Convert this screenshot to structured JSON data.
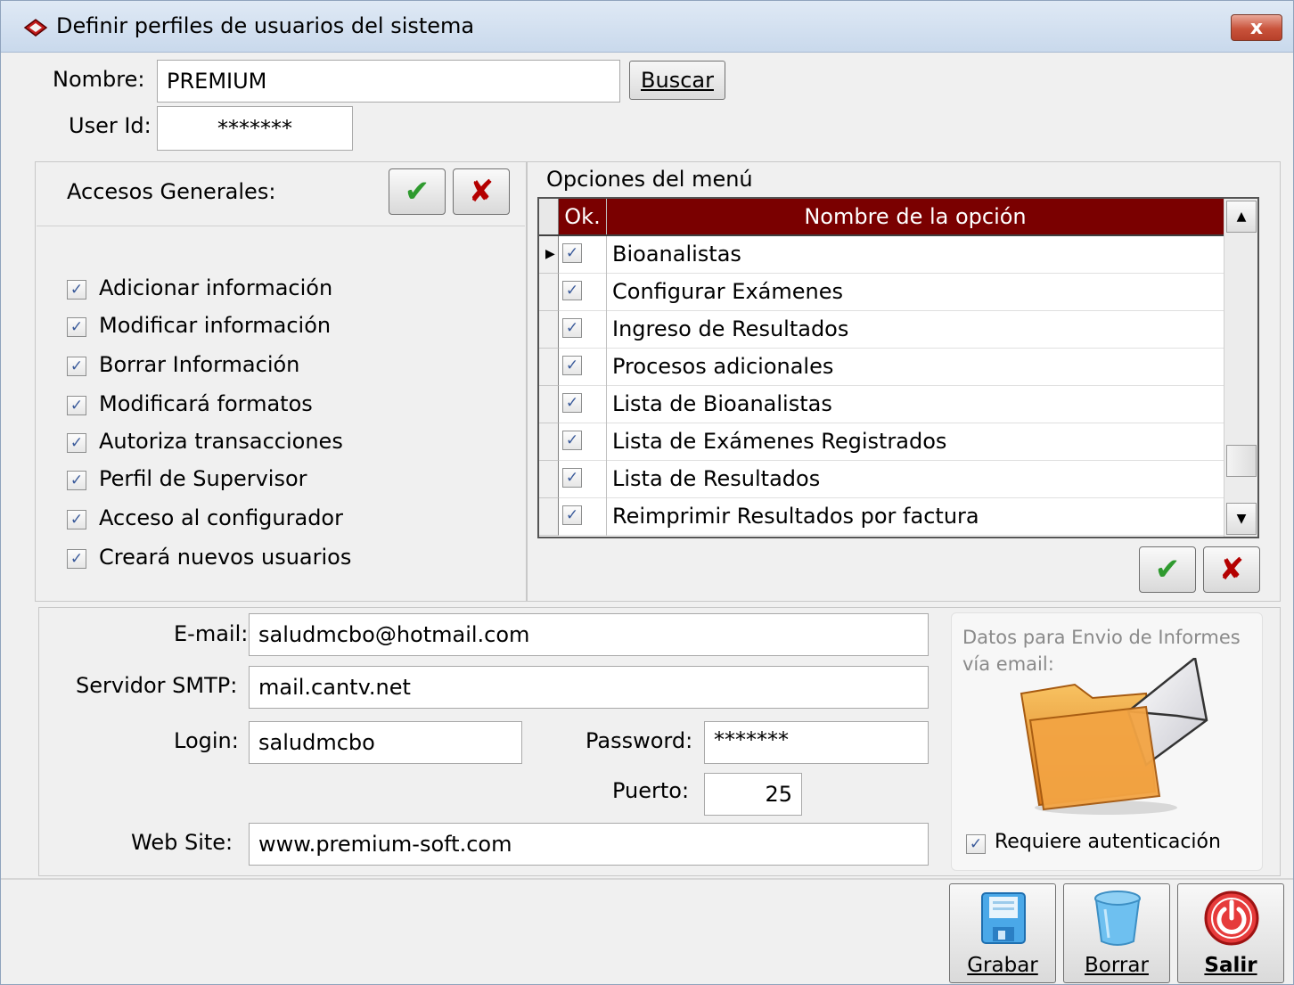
{
  "window": {
    "title": "Definir perfiles de usuarios del sistema",
    "close_label": "x"
  },
  "header": {
    "nombre_label": "Nombre:",
    "nombre_value": "PREMIUM",
    "buscar_label": "Buscar",
    "userid_label": "User Id:",
    "userid_value": "*******"
  },
  "accesos": {
    "title": "Accesos Generales:",
    "items": [
      {
        "label": "Adicionar información",
        "checked": true
      },
      {
        "label": "Modificar información",
        "checked": true
      },
      {
        "label": "Borrar Información",
        "checked": true
      },
      {
        "label": "Modificará formatos",
        "checked": true
      },
      {
        "label": "Autoriza transacciones",
        "checked": true
      },
      {
        "label": "Perfil de Supervisor",
        "checked": true
      },
      {
        "label": "Acceso al configurador",
        "checked": true
      },
      {
        "label": "Creará nuevos usuarios",
        "checked": true
      }
    ]
  },
  "menu": {
    "title": "Opciones del menú",
    "col_ok": "Ok.",
    "col_name": "Nombre de la opción",
    "rows": [
      {
        "name": "Bioanalistas",
        "checked": true
      },
      {
        "name": "Configurar Exámenes",
        "checked": true
      },
      {
        "name": "Ingreso de Resultados",
        "checked": true
      },
      {
        "name": "Procesos adicionales",
        "checked": true
      },
      {
        "name": "Lista de Bioanalistas",
        "checked": true
      },
      {
        "name": "Lista de Exámenes Registrados",
        "checked": true
      },
      {
        "name": "Lista de Resultados",
        "checked": true
      },
      {
        "name": "Reimprimir Resultados por factura",
        "checked": true
      }
    ]
  },
  "email": {
    "email_label": "E-mail:",
    "email_value": "saludmcbo@hotmail.com",
    "smtp_label": "Servidor SMTP:",
    "smtp_value": "mail.cantv.net",
    "login_label": "Login:",
    "login_value": "saludmcbo",
    "password_label": "Password:",
    "password_value": "*******",
    "puerto_label": "Puerto:",
    "puerto_value": "25",
    "website_label": "Web Site:",
    "website_value": "www.premium-soft.com",
    "info_text": "Datos para Envio de Informes vía email:",
    "auth_label": "Requiere autenticación",
    "auth_checked": true
  },
  "footer": {
    "grabar_label": "Grabar",
    "borrar_label": "Borrar",
    "salir_label": "Salir"
  },
  "icons": {
    "check": "green-check-icon",
    "cross": "red-x-icon",
    "save": "floppy-disk-icon",
    "delete": "trash-bin-icon",
    "exit": "power-icon",
    "mail": "envelope-folder-icon"
  },
  "colors": {
    "grid_header": "#7a0000",
    "check_green": "#2f9a2f",
    "cross_red": "#b40000",
    "titlebar": "#c9d9ec"
  }
}
